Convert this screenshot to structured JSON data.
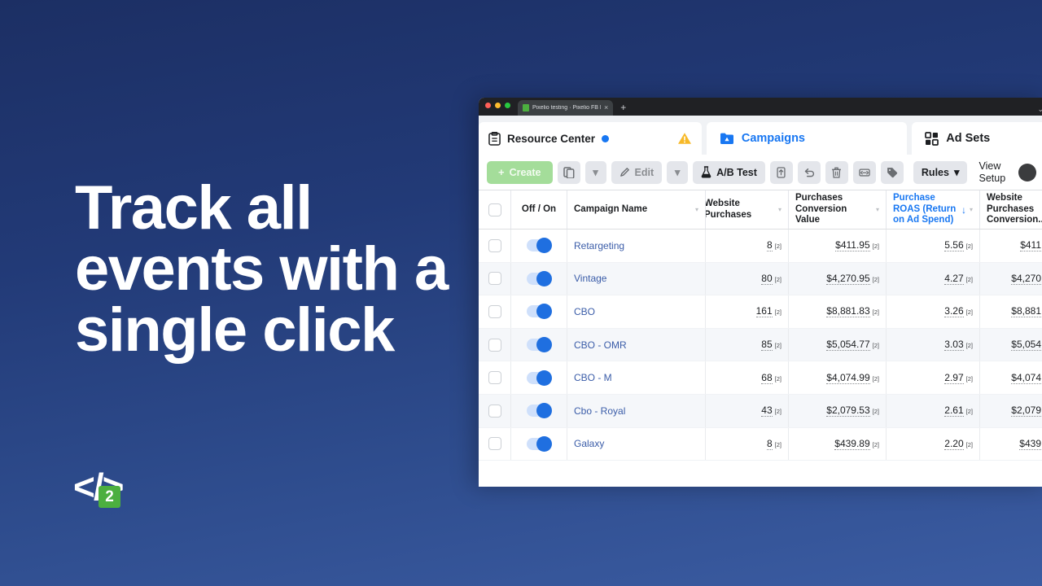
{
  "hero": {
    "lines": [
      "Track all",
      "events with a",
      "single click"
    ],
    "logo_glyph": "</>",
    "logo_badge": "2"
  },
  "browser": {
    "tab_title": "Pixelio testing · Pixelio FB Fac",
    "tab_close": "×",
    "new_tab": "+",
    "caret": "⌄",
    "favicon_name": "pixelio-favicon"
  },
  "app": {
    "resource_center": {
      "label": "Resource Center",
      "has_status_dot": true
    },
    "tabs": [
      {
        "label": "Campaigns",
        "icon": "campaign-folder-icon",
        "active": true
      },
      {
        "label": "Ad Sets",
        "icon": "grid-squares-icon",
        "active": false
      }
    ]
  },
  "toolbar": {
    "create_label": "Create",
    "create_icon": "plus-icon",
    "duplicate_icon": "duplicate-icon",
    "duplicate_caret": "▾",
    "edit_label": "Edit",
    "edit_icon": "pencil-icon",
    "edit_caret": "▾",
    "abtest_label": "A/B Test",
    "abtest_icon": "flask-icon",
    "export_icon": "export-icon",
    "undo_icon": "undo-icon",
    "delete_icon": "trash-icon",
    "share_icon": "share-icon",
    "tag_icon": "tag-icon",
    "rules_label": "Rules",
    "rules_caret": "▾",
    "view_setup_line1": "View",
    "view_setup_line2": "Setup",
    "view_toggle": "view-setup-toggle"
  },
  "table": {
    "columns": [
      {
        "key": "check",
        "label": "",
        "type": "checkbox"
      },
      {
        "key": "onoff",
        "label": "Off / On",
        "type": "toggle"
      },
      {
        "key": "name",
        "label": "Campaign Name",
        "caret": true
      },
      {
        "key": "wp",
        "label": "Website Purchases",
        "caret": true,
        "clipped": true
      },
      {
        "key": "pcv",
        "label": "Purchases Conversion Value",
        "caret": true
      },
      {
        "key": "roas",
        "label": "Purchase ROAS (Return on Ad Spend)",
        "caret": true,
        "sorted": true,
        "sort_arrow": "↓",
        "link": true
      },
      {
        "key": "wpc",
        "label": "Website Purchases Conversion...",
        "clipped": true
      }
    ],
    "superscript": "[2]",
    "rows": [
      {
        "name": "Retargeting",
        "on": true,
        "wp": "8",
        "pcv": "$411.95",
        "roas": "5.56",
        "wpc": "$411"
      },
      {
        "name": "Vintage",
        "on": true,
        "wp": "80",
        "pcv": "$4,270.95",
        "roas": "4.27",
        "wpc": "$4,270"
      },
      {
        "name": "CBO",
        "on": true,
        "wp": "161",
        "pcv": "$8,881.83",
        "roas": "3.26",
        "wpc": "$8,881"
      },
      {
        "name": "CBO - OMR",
        "on": true,
        "wp": "85",
        "pcv": "$5,054.77",
        "roas": "3.03",
        "wpc": "$5,054"
      },
      {
        "name": "CBO - M",
        "on": true,
        "wp": "68",
        "pcv": "$4,074.99",
        "roas": "2.97",
        "wpc": "$4,074"
      },
      {
        "name": "Cbo - Royal",
        "on": true,
        "wp": "43",
        "pcv": "$2,079.53",
        "roas": "2.61",
        "wpc": "$2,079"
      },
      {
        "name": "Galaxy",
        "on": true,
        "wp": "8",
        "pcv": "$439.89",
        "roas": "2.20",
        "wpc": "$439"
      }
    ]
  },
  "colors": {
    "brand_blue": "#1877f2",
    "bg_top": "#1c2f64",
    "bg_bottom": "#3b5ca2",
    "create_green": "#a4dd9a",
    "badge_green": "#4caf3f",
    "warning_amber": "#f7b928",
    "toggle_blue": "#1f6fe0"
  }
}
